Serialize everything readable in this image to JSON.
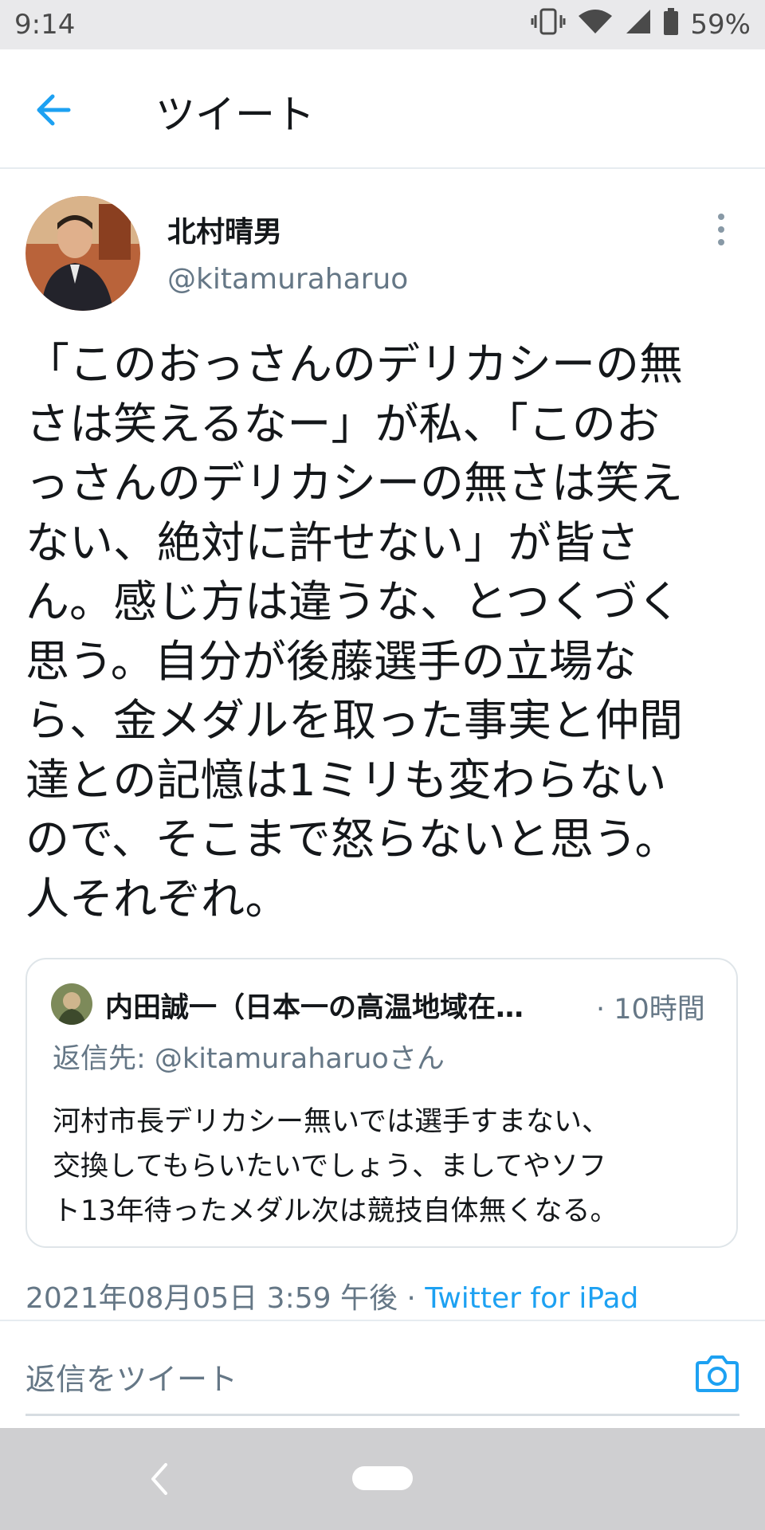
{
  "status_bar": {
    "time": "9:14",
    "battery": "59%"
  },
  "nav": {
    "title": "ツイート"
  },
  "tweet": {
    "display_name": "北村晴男",
    "handle": "@kitamuraharuo",
    "text": "「このおっさんのデリカシーの無\nさは笑えるなー」が私、「このお\nっさんのデリカシーの無さは笑え\nない、絶対に許せない」が皆さ\nん。感じ方は違うな、とつくづく\n思う。自分が後藤選手の立場な\nら、金メダルを取った事実と仲間\n達との記憶は1ミリも変わらない\nので、そこまで怒らないと思う。\n人それぞれ。",
    "timestamp": "2021年08月05日 3:59 午後",
    "separator": " · ",
    "source": "Twitter for iPad"
  },
  "quoted": {
    "display_name": "内田誠一（日本一の高温地域在…",
    "time": "· 10時間",
    "reply_to_label": "返信先: ",
    "reply_to_mention": "@kitamuraharuoさん",
    "text": "河村市長デリカシー無いでは選手すまない、\n交換してもらいたいでしょう、ましてやソフ\nト13年待ったメダル次は競技自体無くなる。"
  },
  "reply": {
    "placeholder": "返信をツイート"
  },
  "colors": {
    "accent": "#1da1f2",
    "secondary_text": "#657786",
    "primary_text": "#14171a"
  }
}
